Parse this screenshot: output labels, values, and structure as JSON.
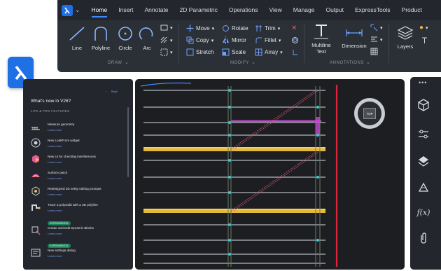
{
  "app": {
    "brand_color": "#1f6fe5",
    "app_button_icon": "bricscad-logo-icon"
  },
  "menu": {
    "tabs": [
      "Home",
      "Insert",
      "Annotate",
      "2D Parametric",
      "Operations",
      "View",
      "Manage",
      "Output",
      "ExpressTools",
      "Product"
    ],
    "active": "Home"
  },
  "ribbon": {
    "draw": {
      "label": "DRAW",
      "line": "Line",
      "polyline": "Polyline",
      "circle": "Circle",
      "arc": "Arc"
    },
    "modify": {
      "label": "MODIFY",
      "move": "Move",
      "rotate": "Rotate",
      "trim": "Trim",
      "copy": "Copy",
      "mirror": "Mirror",
      "fillet": "Fillet",
      "stretch": "Stretch",
      "scale": "Scale",
      "array": "Array"
    },
    "annotations": {
      "label": "ANNOTATIONS",
      "multiline_text_1": "Multiline",
      "multiline_text_2": "Text",
      "dimension": "Dimension"
    },
    "layers": {
      "label": "Layers"
    }
  },
  "whats_new": {
    "back": "Back",
    "title": "What's new in V26?",
    "section": "LITE & PRO FEATURES",
    "items": [
      {
        "title": "Measure geometry",
        "link": "Learn more",
        "badge": ""
      },
      {
        "title": "New LookFrom widget",
        "link": "Learn more",
        "badge": ""
      },
      {
        "title": "New UI for checking interferences",
        "link": "Learn more",
        "badge": ""
      },
      {
        "title": "Surface patch",
        "link": "Learn more",
        "badge": ""
      },
      {
        "title": "Redesigned 2D entity editing prompts",
        "link": "Learn more",
        "badge": ""
      },
      {
        "title": "Trace a polysolid with a 3D polyline",
        "link": "Learn more",
        "badge": ""
      },
      {
        "title": "Create and Edit Dynamic Blocks",
        "link": "Learn more",
        "badge": "EXPERIMENTAL"
      },
      {
        "title": "New settings dialog",
        "link": "Learn more",
        "badge": "EXPERIMENTAL"
      }
    ]
  },
  "viewcube": {
    "face": "TOP"
  },
  "right_rail": {
    "icons": [
      "more-icon",
      "properties-icon",
      "settings-sliders-icon",
      "layers-panel-icon",
      "tool-palette-icon",
      "formula-icon",
      "attach-icon"
    ],
    "formula": "f(x)"
  }
}
